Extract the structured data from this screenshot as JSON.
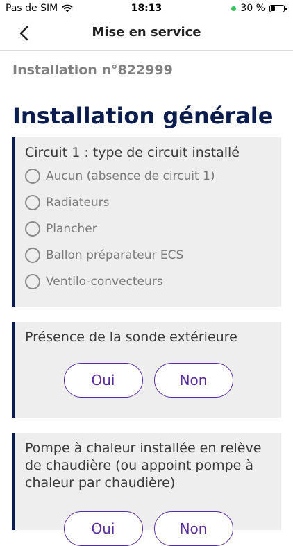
{
  "status_bar": {
    "carrier": "Pas de SIM",
    "time": "18:13",
    "battery_text": "30 %",
    "battery_level": 0.3
  },
  "navbar": {
    "title": "Mise en service",
    "back_icon": "chevron-left-icon"
  },
  "installation_number": "Installation n°822999",
  "section_title": "Installation générale",
  "circuit_question": {
    "title": "Circuit 1 : type de circuit installé",
    "options": [
      "Aucun (absence de circuit 1)",
      "Radiateurs",
      "Plancher",
      "Ballon préparateur ECS",
      "Ventilo-convecteurs"
    ]
  },
  "sonde_question": {
    "title": "Présence de la sonde extérieure",
    "yes_label": "Oui",
    "no_label": "Non"
  },
  "pac_question": {
    "title": "Pompe à chaleur installée en relève de chaudière (ou appoint pompe à chaleur par chaudière)",
    "yes_label": "Oui",
    "no_label": "Non"
  },
  "colors": {
    "accent": "#0b1d4e",
    "button": "#5a2d9c",
    "card_bg": "#eeeeee"
  }
}
